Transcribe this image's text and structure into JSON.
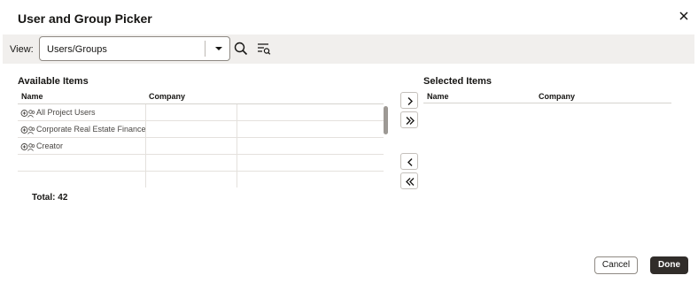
{
  "dialog": {
    "title": "User and Group Picker",
    "close_icon": "close-icon"
  },
  "toolbar": {
    "view_label": "View:",
    "view_value": "Users/Groups",
    "dropdown_icon": "caret-down-icon",
    "search_icon": "search-icon",
    "filter_icon": "filter-list-icon"
  },
  "available": {
    "title": "Available Items",
    "columns": [
      "Name",
      "Company"
    ],
    "rows": [
      {
        "name": "All Project Users",
        "company": ""
      },
      {
        "name": "Corporate Real Estate Finance",
        "company": ""
      },
      {
        "name": "Creator",
        "company": ""
      },
      {
        "name": "",
        "company": ""
      },
      {
        "name": "",
        "company": ""
      }
    ],
    "total": "Total: 42"
  },
  "move_buttons": {
    "add": "chevron-right-icon",
    "add_all": "double-chevron-right-icon",
    "remove": "chevron-left-icon",
    "remove_all": "double-chevron-left-icon"
  },
  "selected": {
    "title": "Selected Items",
    "columns": [
      "Name",
      "Company"
    ]
  },
  "footer": {
    "cancel_label": "Cancel",
    "done_label": "Done"
  },
  "colors": {
    "toolbar_bg": "#f1efed",
    "primary_button": "#312d2a",
    "text": "#161513"
  }
}
